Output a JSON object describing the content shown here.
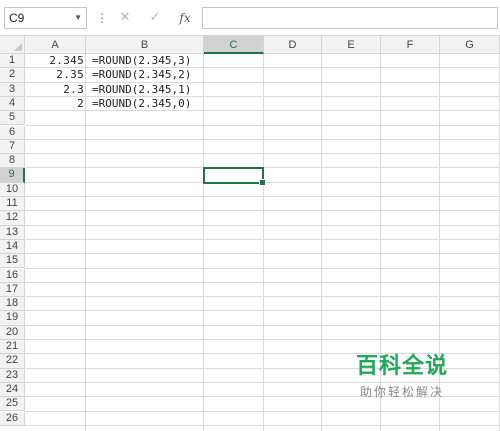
{
  "formula_bar": {
    "name_box": "C9",
    "separator_icon": "vertical-ellipsis-icon",
    "cancel_icon": "close-icon",
    "enter_icon": "check-icon",
    "fx_label": "fx",
    "formula_value": ""
  },
  "columns": [
    "A",
    "B",
    "C",
    "D",
    "E",
    "F",
    "G"
  ],
  "rows": [
    "1",
    "2",
    "3",
    "4",
    "5",
    "6",
    "7",
    "8",
    "9",
    "10",
    "11",
    "12",
    "13",
    "14",
    "15",
    "16",
    "17",
    "18",
    "19",
    "20",
    "21",
    "22",
    "23",
    "24",
    "25",
    "26"
  ],
  "active_cell": {
    "column": "C",
    "row": "9"
  },
  "cells": {
    "A1": "2.345",
    "B1": "=ROUND(2.345,3)",
    "A2": "2.35",
    "B2": "=ROUND(2.345,2)",
    "A3": "2.3",
    "B3": "=ROUND(2.345,1)",
    "A4": "2",
    "B4": "=ROUND(2.345,0)"
  },
  "watermark": {
    "title": "百科全说",
    "subtitle": "助你轻松解决"
  },
  "colors": {
    "accent": "#217346",
    "header_bg": "#f2f2f2",
    "gridline": "#dadada",
    "watermark_green": "#1fa857"
  }
}
